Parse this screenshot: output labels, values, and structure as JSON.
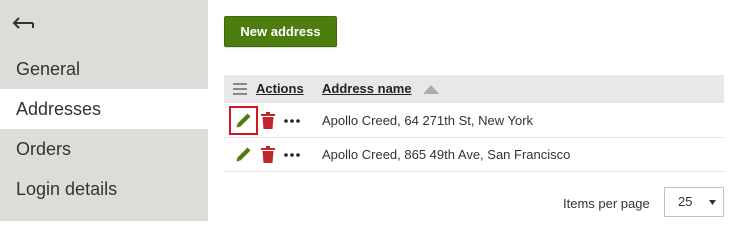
{
  "sidebar": {
    "back_icon": "back-arrow-icon",
    "items": [
      {
        "label": "General",
        "active": false
      },
      {
        "label": "Addresses",
        "active": true
      },
      {
        "label": "Orders",
        "active": false
      },
      {
        "label": "Login details",
        "active": false
      }
    ]
  },
  "toolbar": {
    "new_address_label": "New address"
  },
  "table": {
    "columns": {
      "actions": "Actions",
      "address_name": "Address name"
    },
    "sort": {
      "column": "address_name",
      "direction": "ascending"
    },
    "rows": [
      {
        "address_name": "Apollo Creed, 64 271th St, New York",
        "edit_highlighted": true
      },
      {
        "address_name": "Apollo Creed, 865 49th Ave, San Francisco",
        "edit_highlighted": false
      }
    ]
  },
  "pager": {
    "items_per_page_label": "Items per page",
    "items_per_page_value": "25"
  },
  "colors": {
    "sidebar_bg": "#dcddd8",
    "primary_button": "#4d7d0e",
    "edit_icon": "#4d7d0e",
    "delete_icon": "#c0272d",
    "highlight_border": "#d2181e",
    "header_bg": "#e8e8e8"
  }
}
